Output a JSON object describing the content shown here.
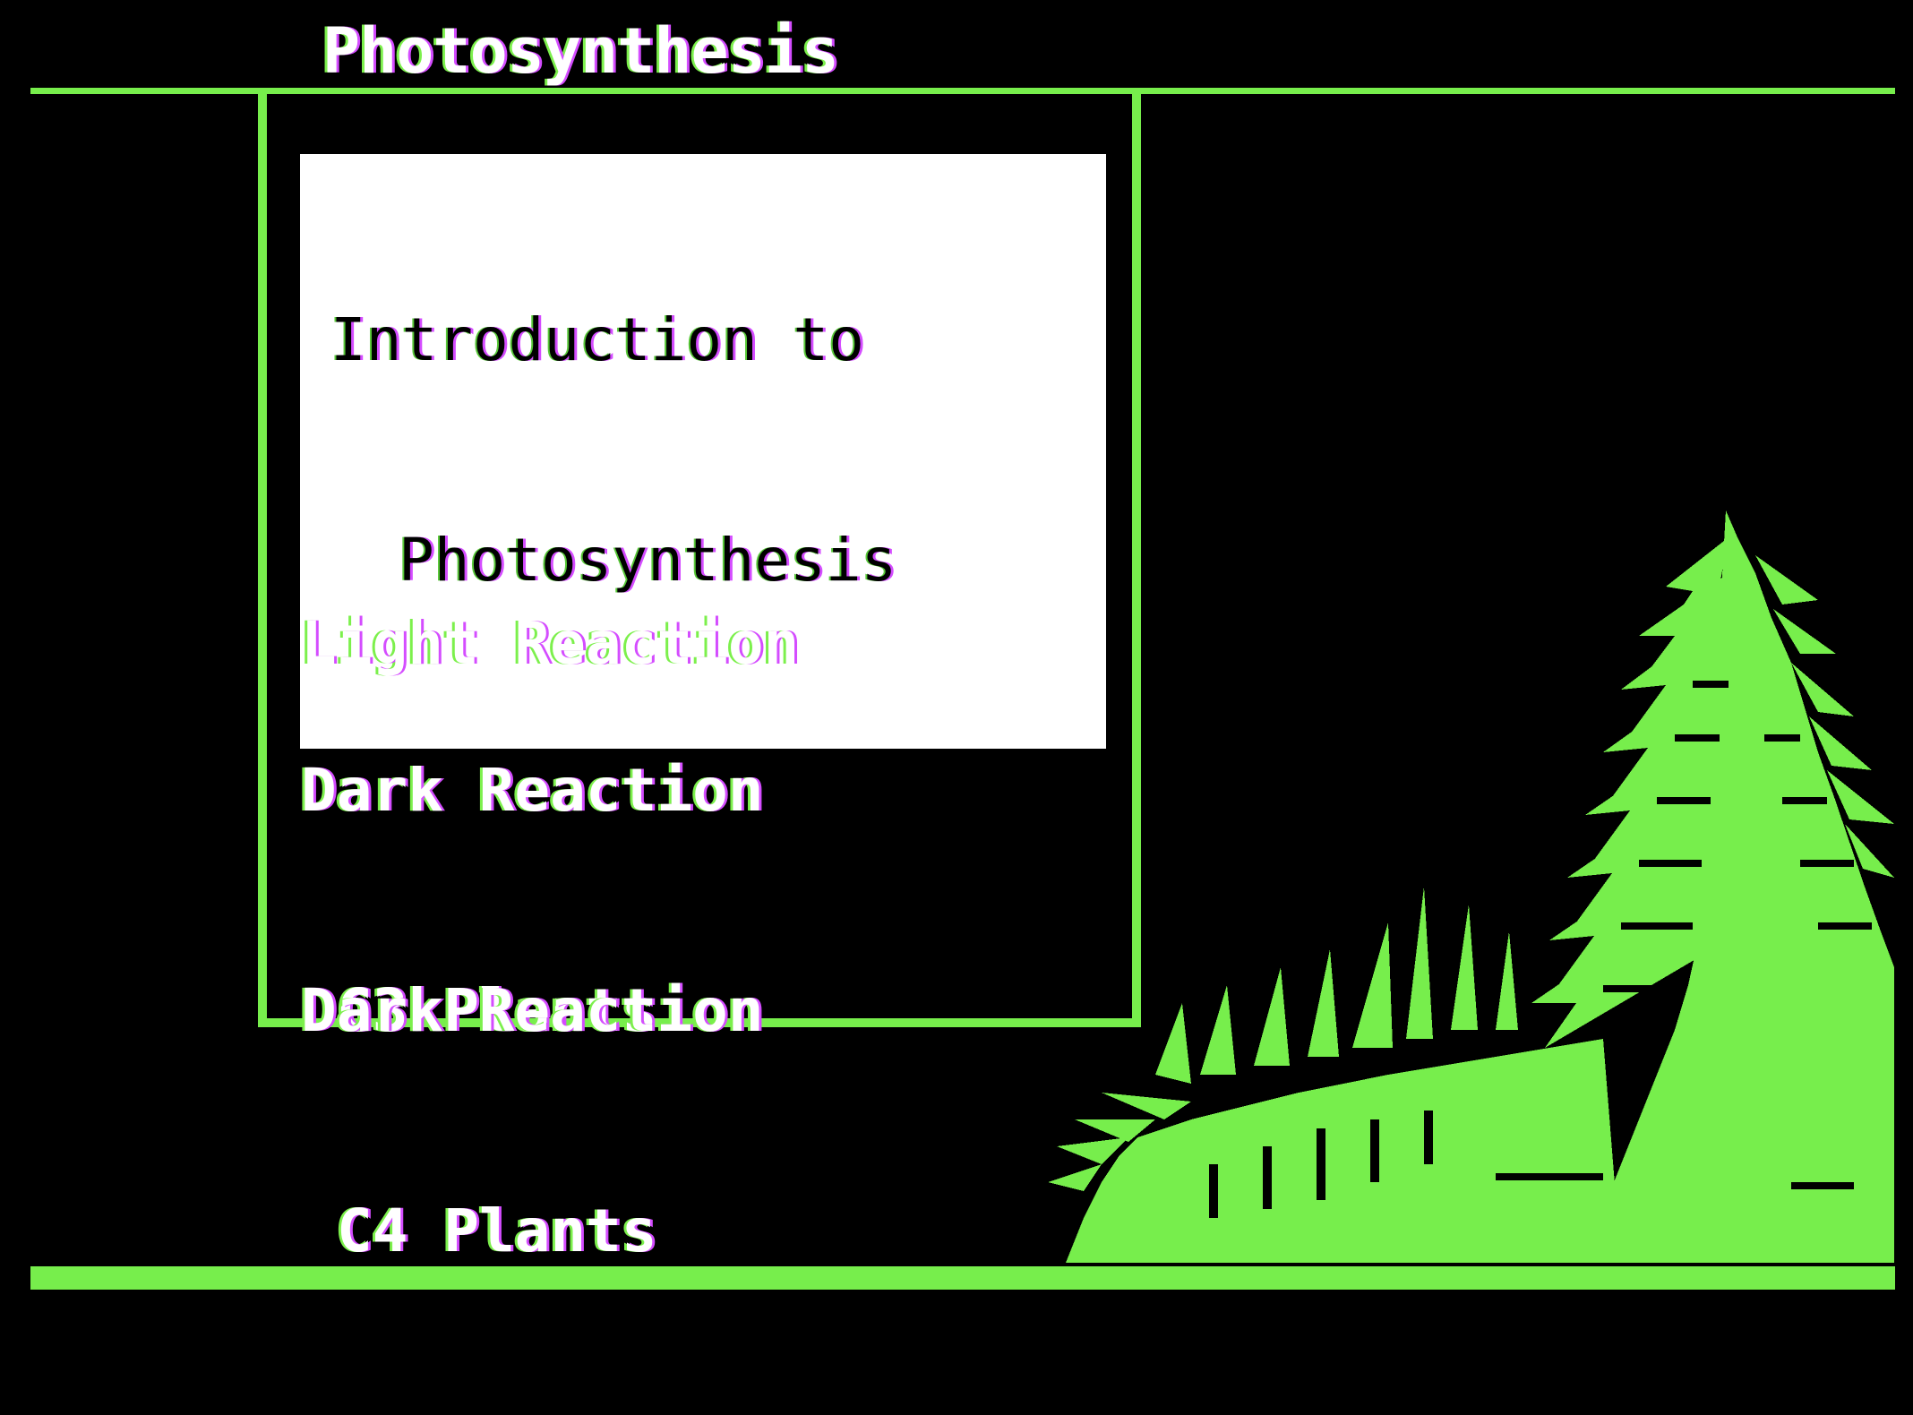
{
  "app": {
    "title": "Photosynthesis"
  },
  "colors": {
    "background": "#000000",
    "accent_green": "#77ee4c",
    "text": "#ffffff",
    "fringe_magenta": "#d44cff"
  },
  "menu": {
    "items": [
      {
        "lines": [
          "Introduction to",
          "Photosynthesis"
        ],
        "selected": true
      },
      {
        "lines": [
          "Light Reaction"
        ],
        "selected": false
      },
      {
        "lines": [
          "Dark Reaction",
          "C3 Plants"
        ],
        "selected": false
      },
      {
        "lines": [
          "Dark Reaction",
          "C4 Plants"
        ],
        "selected": false
      }
    ]
  },
  "decoration": {
    "icon": "pine-tree-and-grass-illustration"
  }
}
